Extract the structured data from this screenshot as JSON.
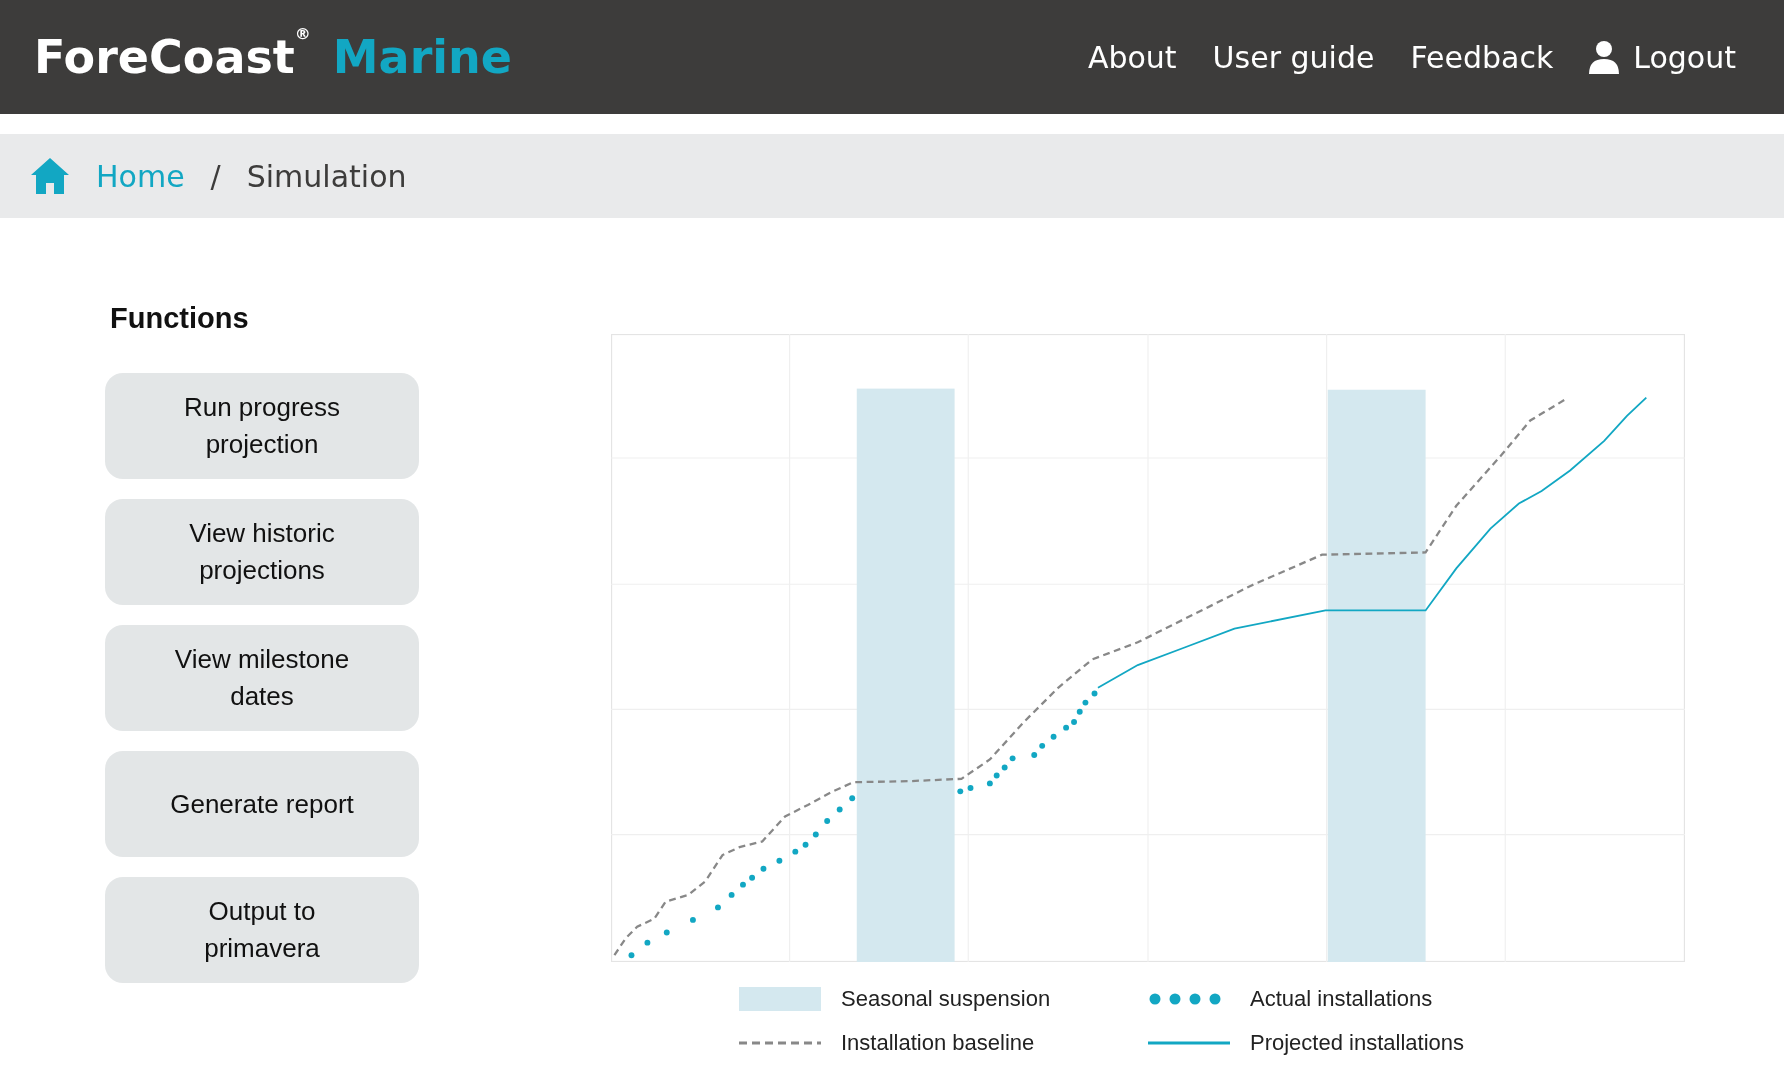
{
  "header": {
    "logo": {
      "name": "ForeCoast",
      "mark": "®",
      "product": "Marine"
    },
    "nav": [
      {
        "label": "About",
        "kind": "link"
      },
      {
        "label": "User guide",
        "kind": "link"
      },
      {
        "label": "Feedback",
        "kind": "link"
      },
      {
        "label": "Logout",
        "kind": "user"
      }
    ]
  },
  "breadcrumb": {
    "separator": "/",
    "items": [
      {
        "label": "Home",
        "kind": "home"
      },
      {
        "label": "Simulation",
        "kind": "current"
      }
    ]
  },
  "functions": {
    "title": "Functions",
    "buttons": [
      "Run progress projection",
      "View historic projections",
      "View milestone dates",
      "Generate report",
      "Output to primavera"
    ]
  },
  "chart": {
    "legend": [
      {
        "label": "Seasonal suspension",
        "kind": "band"
      },
      {
        "label": "Actual installations",
        "kind": "dots"
      },
      {
        "label": "Installation baseline",
        "kind": "dash"
      },
      {
        "label": "Projected installations",
        "kind": "line"
      }
    ]
  }
}
